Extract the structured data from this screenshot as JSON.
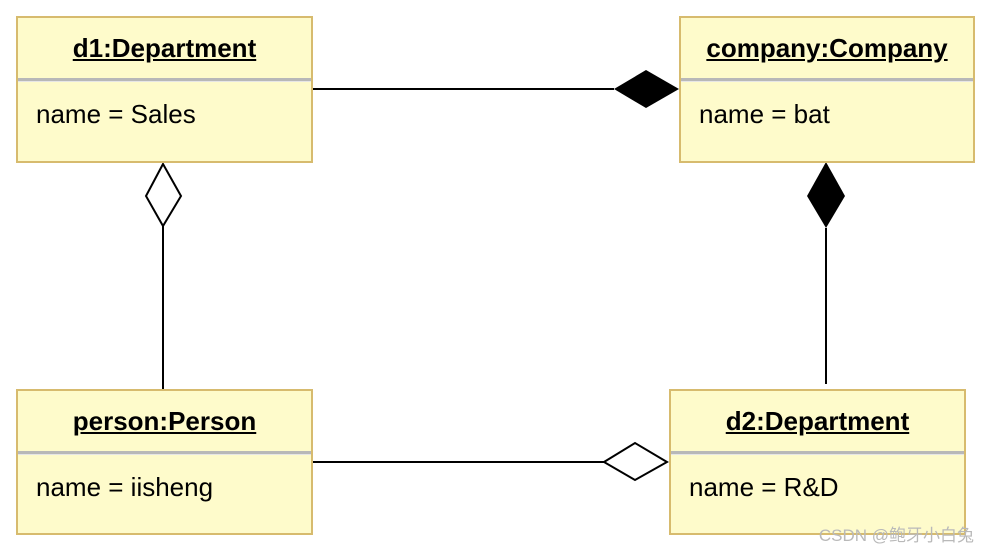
{
  "diagram": {
    "type": "UML object diagram",
    "objects": [
      {
        "id": "d1",
        "title": "d1:Department",
        "attributes": [
          "name = Sales"
        ]
      },
      {
        "id": "company",
        "title": "company:Company",
        "attributes": [
          "name = bat"
        ]
      },
      {
        "id": "person",
        "title": "person:Person",
        "attributes": [
          "name = iisheng"
        ]
      },
      {
        "id": "d2",
        "title": "d2:Department",
        "attributes": [
          "name = R&D"
        ]
      }
    ],
    "links": [
      {
        "from": "d1",
        "to": "company",
        "kind": "composition",
        "diamond_at": "company"
      },
      {
        "from": "d2",
        "to": "company",
        "kind": "composition",
        "diamond_at": "company"
      },
      {
        "from": "person",
        "to": "d1",
        "kind": "aggregation",
        "diamond_at": "d1"
      },
      {
        "from": "person",
        "to": "d2",
        "kind": "aggregation",
        "diamond_at": "d2"
      }
    ],
    "colors": {
      "fill": "#fefbcb",
      "border": "#d7bb6e",
      "line": "#000000"
    }
  },
  "watermark": "CSDN @鲍牙小白兔"
}
